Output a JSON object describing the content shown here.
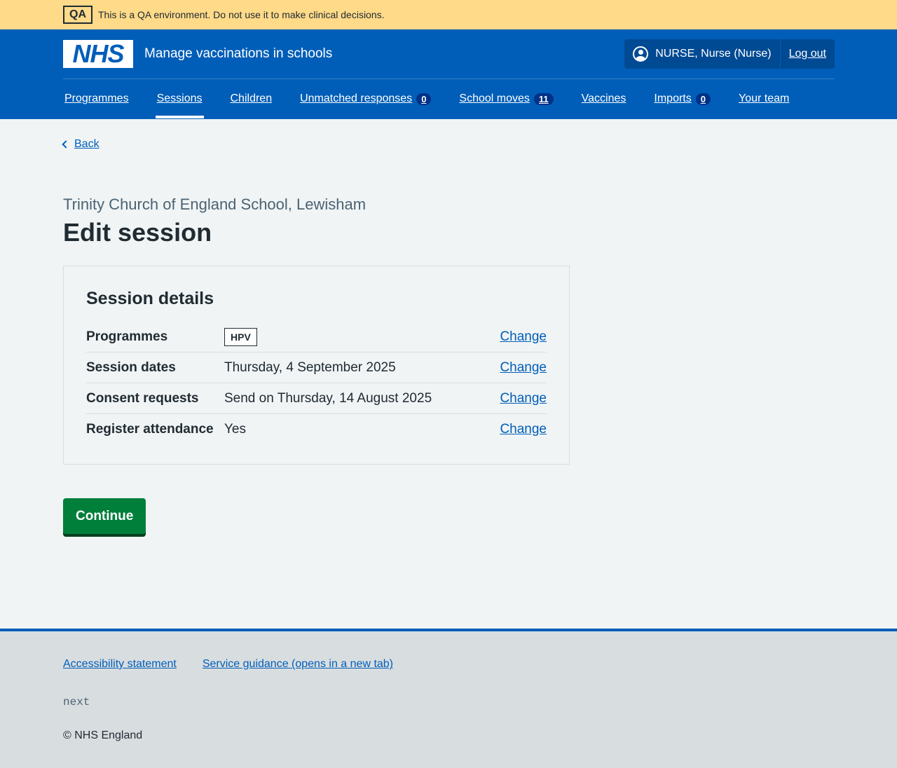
{
  "env_banner": {
    "tag": "QA",
    "text": "This is a QA environment. Do not use it to make clinical decisions."
  },
  "header": {
    "logo_text": "NHS",
    "service_name": "Manage vaccinations in schools",
    "user": "NURSE, Nurse (Nurse)",
    "logout": "Log out"
  },
  "nav": {
    "programmes": "Programmes",
    "sessions": "Sessions",
    "children": "Children",
    "unmatched": "Unmatched responses",
    "unmatched_count": "0",
    "school_moves": "School moves",
    "school_moves_count": "11",
    "vaccines": "Vaccines",
    "imports": "Imports",
    "imports_count": "0",
    "your_team": "Your team",
    "active": "Sessions"
  },
  "page": {
    "back": "Back",
    "caption": "Trinity Church of England School, Lewisham",
    "title": "Edit session"
  },
  "card": {
    "title": "Session details",
    "rows": [
      {
        "key": "Programmes",
        "value": "HPV",
        "action": "Change"
      },
      {
        "key": "Session dates",
        "value": "Thursday, 4 September 2025",
        "action": "Change"
      },
      {
        "key": "Consent requests",
        "value": "Send on Thursday, 14 August 2025",
        "action": "Change"
      },
      {
        "key": "Register attendance",
        "value": "Yes",
        "action": "Change"
      }
    ]
  },
  "continue_button": "Continue",
  "footer": {
    "accessibility": "Accessibility statement",
    "guidance": "Service guidance (opens in a new tab)",
    "version": "next",
    "copyright": "© NHS England"
  },
  "colors": {
    "nhs_blue": "#005eb8",
    "green": "#007f3b",
    "banner": "#ffda89"
  }
}
